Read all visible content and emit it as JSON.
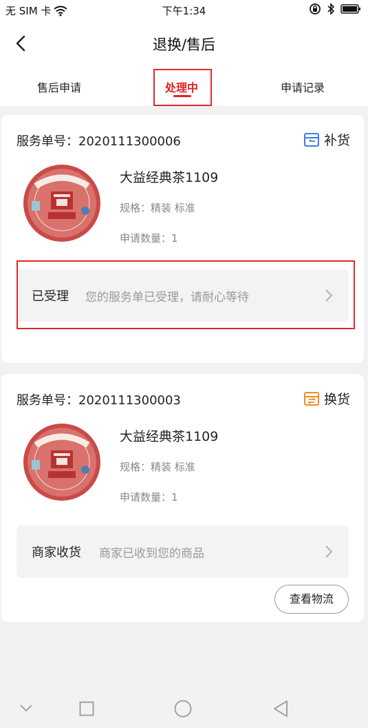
{
  "status_bar": {
    "carrier": "无 SIM 卡",
    "time": "下午1:34"
  },
  "header": {
    "title": "退换/售后"
  },
  "tabs": [
    {
      "label": "售后申请"
    },
    {
      "label": "处理中"
    },
    {
      "label": "申请记录"
    }
  ],
  "orders": [
    {
      "service_no": "服务单号：2020111300006",
      "type_label": "补货",
      "type_icon": "replenish-box-icon",
      "type_color": "#3a7de0",
      "product_name": "大益经典茶1109",
      "spec": "规格：精装 标准",
      "quantity": "申请数量：1",
      "status_label": "已受理",
      "status_desc": "您的服务单已受理，请耐心等待"
    },
    {
      "service_no": "服务单号：2020111300003",
      "type_label": "换货",
      "type_icon": "exchange-box-icon",
      "type_color": "#f08a24",
      "product_name": "大益经典茶1109",
      "spec": "规格：精装 标准",
      "quantity": "申请数量：1",
      "status_label": "商家收货",
      "status_desc": "商家已收到您的商品",
      "action_label": "查看物流"
    }
  ],
  "theme": {
    "accent": "#e02020",
    "highlight": "#e0282a"
  }
}
